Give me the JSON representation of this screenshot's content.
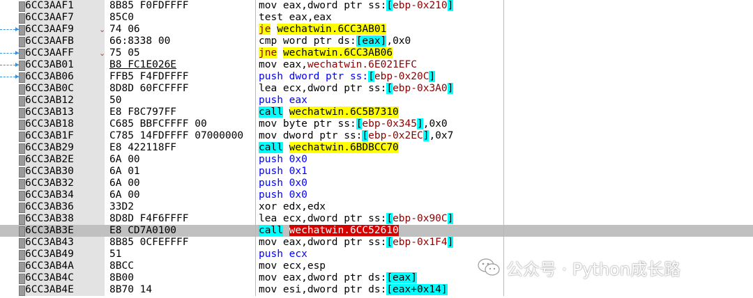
{
  "rows": [
    {
      "addr": "6CC3AAF1",
      "bytes": "8B85 F0FDFFFF"
    },
    {
      "addr": "6CC3AAF7",
      "bytes": "85C0"
    },
    {
      "addr": "6CC3AAF9",
      "bytes": "74 06"
    },
    {
      "addr": "6CC3AAFB",
      "bytes": "66:8338 00"
    },
    {
      "addr": "6CC3AAFF",
      "bytes": "75 05"
    },
    {
      "addr": "6CC3AB01",
      "bytes": "B8 FC1E026E"
    },
    {
      "addr": "6CC3AB06",
      "bytes": "FFB5 F4FDFFFF"
    },
    {
      "addr": "6CC3AB0C",
      "bytes": "8D8D 60FCFFFF"
    },
    {
      "addr": "6CC3AB12",
      "bytes": "50"
    },
    {
      "addr": "6CC3AB13",
      "bytes": "E8 F8C797FF"
    },
    {
      "addr": "6CC3AB18",
      "bytes": "C685 BBFCFFFF 00"
    },
    {
      "addr": "6CC3AB1F",
      "bytes": "C785 14FDFFFF 07000000"
    },
    {
      "addr": "6CC3AB29",
      "bytes": "E8 422118FF"
    },
    {
      "addr": "6CC3AB2E",
      "bytes": "6A 00"
    },
    {
      "addr": "6CC3AB30",
      "bytes": "6A 01"
    },
    {
      "addr": "6CC3AB32",
      "bytes": "6A 00"
    },
    {
      "addr": "6CC3AB34",
      "bytes": "6A 00"
    },
    {
      "addr": "6CC3AB36",
      "bytes": "33D2"
    },
    {
      "addr": "6CC3AB38",
      "bytes": "8D8D F4F6FFFF"
    },
    {
      "addr": "6CC3AB3E",
      "bytes": "E8 CD7A0100"
    },
    {
      "addr": "6CC3AB43",
      "bytes": "8B85 0CFEFFFF"
    },
    {
      "addr": "6CC3AB49",
      "bytes": "51"
    },
    {
      "addr": "6CC3AB4A",
      "bytes": "8BCC"
    },
    {
      "addr": "6CC3AB4C",
      "bytes": "8B00"
    },
    {
      "addr": "6CC3AB4E",
      "bytes": "8B70 14"
    }
  ],
  "asm": {
    "r0a": "mov eax,dword ptr ss:",
    "r0b": "[",
    "r0c": "ebp-0x210",
    "r0d": "]",
    "r1": "test eax,eax",
    "r2a": "je",
    "r2b": "wechatwin.6CC3AB01",
    "r3a": "cmp word ptr ds:",
    "r3b": "[eax]",
    ",r3c": "",
    "r3d": ",0x0",
    "r4a": "jne",
    "r4b": "wechatwin.6CC3AB06",
    "r5a": "mov eax,",
    "r5b": "wechatwin.6E021EFC",
    "r6a": "push dword ptr ss:",
    "r6b": "[",
    "r6c": "ebp-0x20C",
    "r6d": "]",
    "r7a": "lea ecx,dword ptr ss:",
    "r7b": "[",
    "r7c": "ebp-0x3A0",
    "r7d": "]",
    "r8": "push eax",
    "r9a": "call",
    "r9b": "wechatwin.6C5B7310",
    "r10a": "mov byte ptr ss:",
    "r10b": "[",
    "r10c": "ebp-0x345",
    "r10d": "]",
    ",r10e": "",
    "r10f": ",0x0",
    "r11a": "mov dword ptr ss:",
    "r11b": "[",
    "r11c": "ebp-0x2EC",
    "r11d": "]",
    ",r11e": "",
    "r11f": ",0x7",
    "r12a": "call",
    "r12b": "wechatwin.6BDBCC70",
    "r13": "push 0x0",
    "r14": "push 0x1",
    "r15": "push 0x0",
    "r16": "push 0x0",
    "r17": "xor edx,edx",
    "r18a": "lea ecx,dword ptr ss:",
    "r18b": "[",
    "r18c": "ebp-0x90C",
    "r18d": "]",
    "r19a": "call",
    "r19b": "wechatwin.6CC52610",
    "r20a": "mov eax,dword ptr ss:",
    "r20b": "[",
    "r20c": "ebp-0x1F4",
    "r20d": "]",
    "r21": "push ecx",
    "r22": "mov ecx,esp",
    "r23a": "mov eax,dword ptr ds:",
    "r23b": "[eax]",
    "r24a": "mov esi,dword ptr ds:",
    "r24b": "[eax+0x14]"
  },
  "jump_marks": {
    "r2": "⌄",
    "r4": "⌄"
  },
  "watermark": {
    "text": "公众号 · Python成长路",
    "icon": "wechat-icon"
  },
  "colors": {
    "highlight_yellow": "#ffff00",
    "highlight_cyan": "#00ffff",
    "highlight_red": "#d30000",
    "selected_row": "#c0c0c0",
    "arrow": "#3b8fd8"
  }
}
